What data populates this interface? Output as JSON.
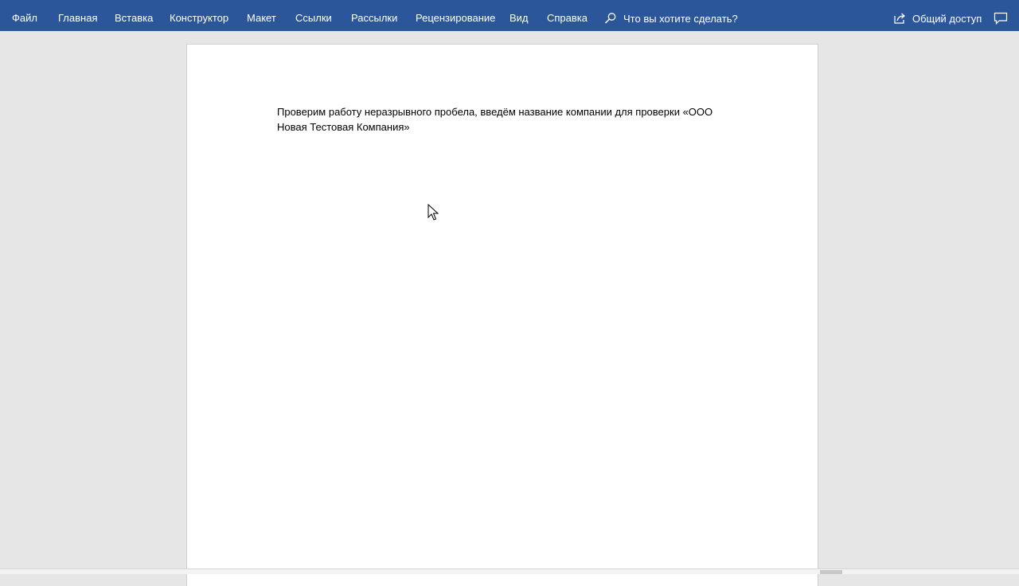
{
  "ribbon": {
    "tabs": [
      {
        "key": "file",
        "label": "Файл"
      },
      {
        "key": "home",
        "label": "Главная"
      },
      {
        "key": "insert",
        "label": "Вставка"
      },
      {
        "key": "design",
        "label": "Конструктор"
      },
      {
        "key": "layout",
        "label": "Макет"
      },
      {
        "key": "references",
        "label": "Ссылки"
      },
      {
        "key": "mailings",
        "label": "Рассылки"
      },
      {
        "key": "review",
        "label": "Рецензирование"
      },
      {
        "key": "view",
        "label": "Вид"
      },
      {
        "key": "help",
        "label": "Справка"
      }
    ],
    "tell_me": "Что вы хотите сделать?",
    "share": "Общий доступ"
  },
  "document": {
    "line1": "Проверим работу неразрывного пробела, введём название компании для проверки «ООО",
    "line2": "Новая Тестовая Компания»"
  },
  "colors": {
    "ribbon": "#2b579a",
    "workspace": "#e6e6e6",
    "page": "#ffffff"
  }
}
